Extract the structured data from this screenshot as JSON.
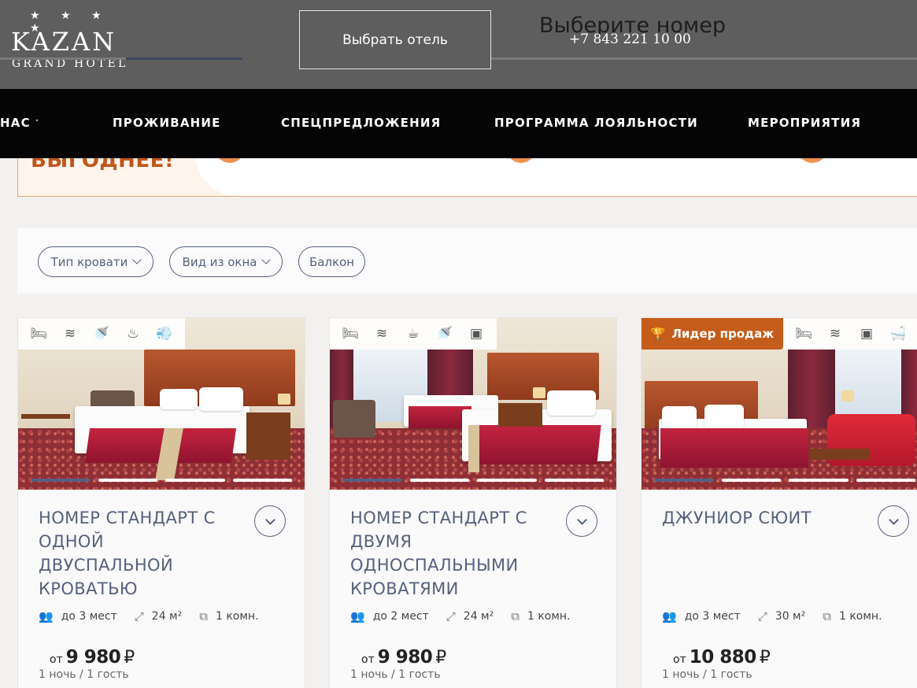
{
  "header": {
    "stars": "★ ★ ★ ★",
    "logo_main": "KAZAN",
    "logo_sub": "GRAND HOTEL",
    "choose_hotel": "Выбрать отель",
    "page_heading": "Выберите номер",
    "phone": "+7 843 221 10 00"
  },
  "nav": {
    "items": [
      "НАС",
      "ПРОЖИВАНИЕ",
      "СПЕЦПРЕДЛОЖЕНИЯ",
      "ПРОГРАММА ЛОЯЛЬНОСТИ",
      "МЕРОПРИЯТИЯ"
    ]
  },
  "banner": {
    "text": "ВЫГОДНЕЕ!"
  },
  "filters": [
    "Тип кровати",
    "Вид из окна",
    "Балкон"
  ],
  "rooms": [
    {
      "title": "Номер стандарт с одной двуспальной кроватью",
      "guests": "до 3 мест",
      "area": "24 м²",
      "rooms": "1 комн.",
      "from": "от",
      "price": "9 980",
      "currency": "₽",
      "per": "1 ночь / 1 гость",
      "amenities": [
        "bed-icon",
        "wifi-icon",
        "shower-icon",
        "spa-icon",
        "hairdryer-icon"
      ]
    },
    {
      "title": "Номер стандарт с двумя односпальными кроватями",
      "guests": "до 2 мест",
      "area": "24 м²",
      "rooms": "1 комн.",
      "from": "от",
      "price": "9 980",
      "currency": "₽",
      "per": "1 ночь / 1 гость",
      "amenities": [
        "bed-icon",
        "wifi-icon",
        "coffee-icon",
        "shower-icon",
        "safe-icon"
      ]
    },
    {
      "title": "Джуниор сюит",
      "guests": "до 3 мест",
      "area": "30 м²",
      "rooms": "1 комн.",
      "from": "от",
      "price": "10 880",
      "currency": "₽",
      "per": "1 ночь / 1 гость",
      "badge": "Лидер продаж",
      "amenities": [
        "bed-icon",
        "wifi-icon",
        "safe-icon",
        "bathtub-icon"
      ]
    }
  ],
  "colors": {
    "accent": "#56607e",
    "badge": "#c45c1b",
    "banner_text": "#c0561a"
  }
}
